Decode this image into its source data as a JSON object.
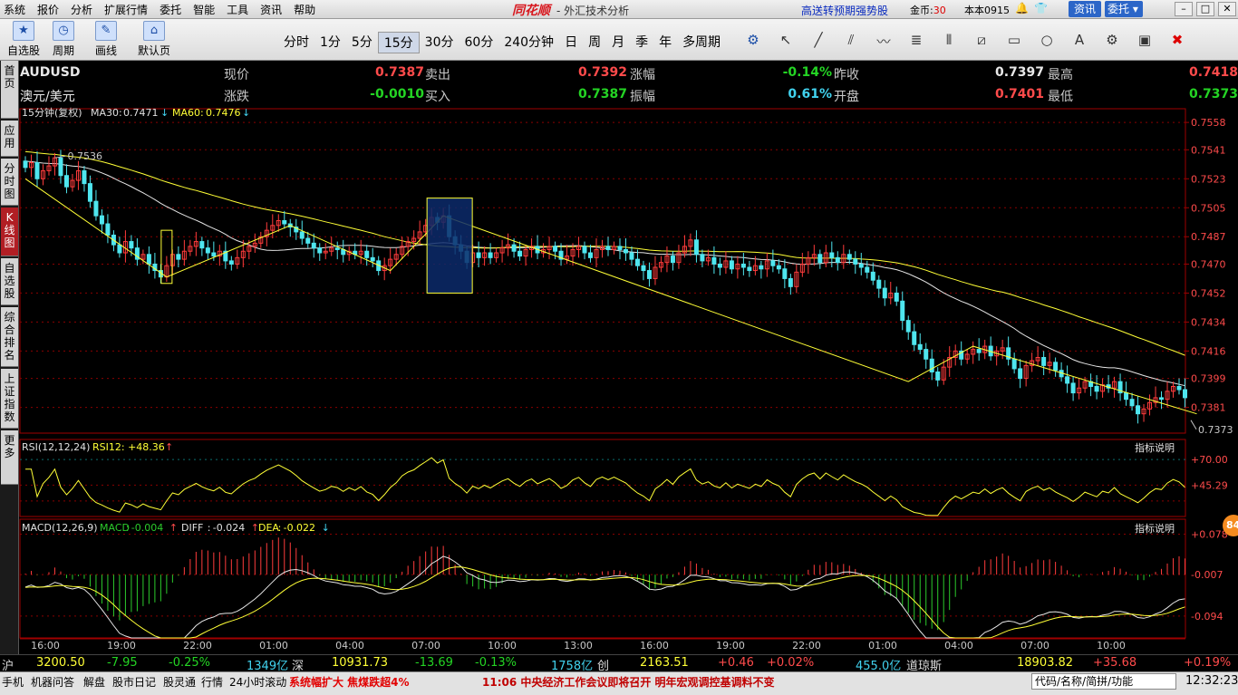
{
  "menu": [
    "系统",
    "报价",
    "分析",
    "扩展行情",
    "委托",
    "智能",
    "工具",
    "资讯",
    "帮助"
  ],
  "app": {
    "logo": "同花顺",
    "title": "- 外汇技术分析",
    "promo": "高送转预期强势股",
    "coins_label": "金币:",
    "coins_value": "30",
    "version": "本本0915",
    "zixun": "资讯",
    "weituo": "委托"
  },
  "toolbar": {
    "buttons": [
      "自选股",
      "周期",
      "画线",
      "默认页"
    ],
    "periods": [
      "分时",
      "1分",
      "5分",
      "15分",
      "30分",
      "60分",
      "240分钟",
      "日",
      "周",
      "月",
      "季",
      "年",
      "多周期"
    ],
    "active_period": "15分"
  },
  "lefttabs": [
    "首页",
    "应用",
    "分时图",
    "K线图",
    "自选股",
    "综合排名",
    "上证指数",
    "更多"
  ],
  "quote": {
    "symbol": "AUDUSD",
    "name": "澳元/美元",
    "fields": [
      {
        "label": "现价",
        "value": "0.7387",
        "color": "red"
      },
      {
        "label": "卖出",
        "value": "0.7392",
        "color": "red"
      },
      {
        "label": "涨幅",
        "value": "-0.14%",
        "color": "green"
      },
      {
        "label": "昨收",
        "value": "0.7397",
        "color": "white"
      },
      {
        "label": "最高",
        "value": "0.7418",
        "color": "red"
      },
      {
        "label": "涨跌",
        "value": "-0.0010",
        "color": "green"
      },
      {
        "label": "买入",
        "value": "0.7387",
        "color": "green"
      },
      {
        "label": "振幅",
        "value": "0.61%",
        "color": "cyan"
      },
      {
        "label": "开盘",
        "value": "0.7401",
        "color": "red"
      },
      {
        "label": "最低",
        "value": "0.7373",
        "color": "green"
      }
    ]
  },
  "chart_data": [
    {
      "type": "candlestick",
      "panel": "price",
      "title": "15分钟(复权)",
      "ma": [
        {
          "name": "MA30",
          "value": "0.7471",
          "arrow": "↓"
        },
        {
          "name": "MA60",
          "value": "0.7476",
          "arrow": "↓"
        }
      ],
      "y_ticks": [
        "0.7558",
        "0.7541",
        "0.7523",
        "0.7505",
        "0.7487",
        "0.7470",
        "0.7452",
        "0.7434",
        "0.7416",
        "0.7399",
        "0.7381"
      ],
      "y_range": [
        0.7365,
        0.7562
      ],
      "annotations": [
        {
          "text": "0.7536",
          "value": 0.7536
        },
        {
          "text": "0.7373",
          "value": 0.7373
        }
      ],
      "series_close": [
        0.753,
        0.7533,
        0.7523,
        0.7528,
        0.7531,
        0.7536,
        0.7525,
        0.7518,
        0.7522,
        0.7528,
        0.752,
        0.7509,
        0.75,
        0.7495,
        0.7488,
        0.7482,
        0.7477,
        0.7484,
        0.748,
        0.7473,
        0.7476,
        0.747,
        0.7466,
        0.7462,
        0.7469,
        0.7476,
        0.7473,
        0.7478,
        0.7481,
        0.7484,
        0.748,
        0.7477,
        0.7475,
        0.7478,
        0.7472,
        0.747,
        0.7474,
        0.7478,
        0.7481,
        0.7483,
        0.7487,
        0.7491,
        0.7494,
        0.7497,
        0.7495,
        0.7493,
        0.749,
        0.7486,
        0.7483,
        0.748,
        0.7477,
        0.7478,
        0.748,
        0.7479,
        0.7476,
        0.7478,
        0.7476,
        0.7478,
        0.7474,
        0.7472,
        0.7466,
        0.7469,
        0.7473,
        0.7476,
        0.7481,
        0.7484,
        0.7486,
        0.749,
        0.7494,
        0.7499,
        0.7496,
        0.75,
        0.7487,
        0.7482,
        0.7478,
        0.7471,
        0.7477,
        0.7474,
        0.7477,
        0.7474,
        0.7477,
        0.748,
        0.7482,
        0.7478,
        0.7475,
        0.7479,
        0.7481,
        0.7477,
        0.7479,
        0.7481,
        0.7478,
        0.7473,
        0.7475,
        0.7479,
        0.7481,
        0.7477,
        0.7474,
        0.7479,
        0.7481,
        0.7479,
        0.7481,
        0.7479,
        0.7477,
        0.7473,
        0.7469,
        0.7466,
        0.7461,
        0.7468,
        0.7471,
        0.7475,
        0.7471,
        0.7477,
        0.7481,
        0.7485,
        0.7476,
        0.7472,
        0.7474,
        0.747,
        0.7468,
        0.7472,
        0.7467,
        0.747,
        0.7468,
        0.7466,
        0.7469,
        0.7467,
        0.7472,
        0.7469,
        0.7467,
        0.7461,
        0.7456,
        0.7465,
        0.747,
        0.7474,
        0.7476,
        0.7471,
        0.7477,
        0.7474,
        0.7471,
        0.7476,
        0.7473,
        0.747,
        0.7468,
        0.7465,
        0.746,
        0.7455,
        0.7449,
        0.7452,
        0.7447,
        0.7435,
        0.7428,
        0.742,
        0.7417,
        0.7411,
        0.7403,
        0.7398,
        0.7406,
        0.7412,
        0.7416,
        0.7411,
        0.7414,
        0.7417,
        0.7415,
        0.7419,
        0.7413,
        0.7416,
        0.7418,
        0.7411,
        0.7405,
        0.7399,
        0.7407,
        0.741,
        0.7412,
        0.7407,
        0.7409,
        0.7404,
        0.74,
        0.7396,
        0.739,
        0.7393,
        0.7397,
        0.7394,
        0.7391,
        0.7395,
        0.7393,
        0.7397,
        0.739,
        0.7386,
        0.7382,
        0.7377,
        0.738,
        0.7384,
        0.7387,
        0.7386,
        0.7391,
        0.7394,
        0.7392,
        0.7387
      ]
    },
    {
      "type": "line",
      "panel": "RSI",
      "title": "RSI(12,12,24)",
      "readout": "RSI12: +48.36",
      "readout_arrow": "↑",
      "y_ticks": [
        "+70.00",
        "+45.29"
      ],
      "y_range": [
        15,
        85
      ],
      "button": "指标说明"
    },
    {
      "type": "bar+line",
      "panel": "MACD",
      "title": "MACD(12,26,9)",
      "readouts": [
        {
          "name": "MACD",
          "value": "-0.004",
          "arrow": "↑",
          "color": "green"
        },
        {
          "name": "DIFF",
          "value": "-0.024",
          "arrow": "↑",
          "color": "white"
        },
        {
          "name": "DEA",
          "value": "-0.022",
          "arrow": "↓",
          "color": "yellow"
        }
      ],
      "y_ticks": [
        "+0.078",
        "-0.007",
        "-0.094"
      ],
      "y_range": [
        -0.14,
        0.1
      ],
      "button": "指标说明"
    }
  ],
  "x_ticks": [
    "16:00",
    "19:00",
    "22:00",
    "01:00",
    "04:00",
    "07:00",
    "10:00",
    "13:00",
    "16:00",
    "19:00",
    "22:00",
    "01:00",
    "04:00",
    "07:00",
    "10:00"
  ],
  "footer": {
    "sh_label": "沪",
    "sh_value": "3200.50",
    "sh_chg": "-7.95",
    "sh_pct": "-0.25%",
    "sh_amt": "1349亿",
    "sz_label": "深",
    "sz_value": "10931.73",
    "sz_chg": "-13.69",
    "sz_pct": "-0.13%",
    "sz_amt": "1758亿",
    "cy_label": "创",
    "cy_value": "2163.51",
    "cy_chg": "+0.46",
    "cy_pct": "+0.02%",
    "cy_amt": "455.0亿",
    "dj_label": "道琼斯",
    "dj_value": "18903.82",
    "dj_chg": "+35.68",
    "dj_pct": "+0.19%"
  },
  "statusbar": {
    "items": [
      "手机",
      "机器问答",
      "解盘",
      "股市日记",
      "股灵通",
      "行情",
      "24小时滚动"
    ],
    "ticker": "系统幅扩大 焦煤跌超4%",
    "news": "11:06 中央经济工作会议即将召开 明年宏观调控基调料不变",
    "codebox": "代码/名称/简拼/功能",
    "time": "12:32:23"
  },
  "badge": "84"
}
